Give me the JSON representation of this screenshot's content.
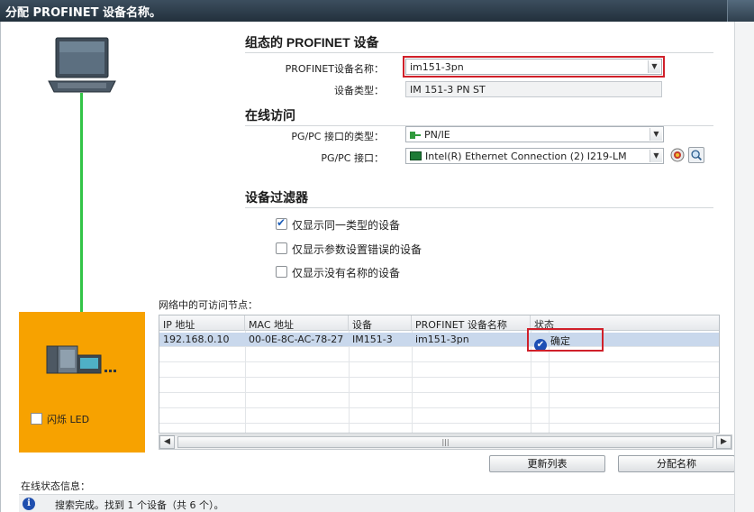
{
  "window": {
    "title": "分配 PROFINET 设备名称。"
  },
  "configured": {
    "title": "组态的 PROFINET 设备",
    "name_label": "PROFINET设备名称：",
    "name_value": "im151-3pn",
    "type_label": "设备类型：",
    "type_value": "IM 151-3 PN ST"
  },
  "online": {
    "title": "在线访问",
    "iface_type_label": "PG/PC 接口的类型：",
    "iface_type_value": "PN/IE",
    "iface_label": "PG/PC 接口：",
    "iface_value": "Intel(R) Ethernet Connection (2) I219-LM",
    "iface_type_icon": "ethernet-plug-icon",
    "iface_icon": "network-card-icon"
  },
  "filter": {
    "title": "设备过滤器",
    "options": [
      {
        "label": "仅显示同一类型的设备",
        "checked": true
      },
      {
        "label": "仅显示参数设置错误的设备",
        "checked": false
      },
      {
        "label": "仅显示没有名称的设备",
        "checked": false
      }
    ]
  },
  "nodes": {
    "title": "网络中的可访问节点：",
    "columns": [
      "IP 地址",
      "MAC 地址",
      "设备",
      "PROFINET 设备名称",
      "状态"
    ],
    "rows": [
      {
        "ip": "192.168.0.10",
        "mac": "00-0E-8C-AC-78-27",
        "device": "IM151-3",
        "name": "im151-3pn",
        "status": "确定",
        "status_icon": "check-circle-icon"
      }
    ]
  },
  "led": {
    "label": "闪烁 LED",
    "checked": false
  },
  "buttons": {
    "update_list": "更新列表",
    "assign_name": "分配名称"
  },
  "status": {
    "title": "在线状态信息：",
    "message": "搜索完成。找到 1 个设备（共 6 个）。",
    "icon": "info-icon"
  },
  "colors": {
    "highlight_box": "#d0202a",
    "device_panel": "#f7a200",
    "link_line": "#33c447",
    "selected_row": "#c9d8ec"
  }
}
